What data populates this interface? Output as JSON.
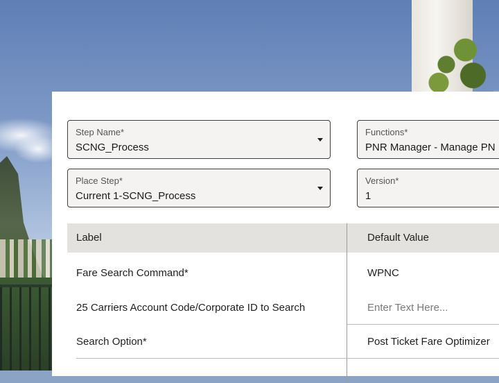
{
  "form": {
    "step_name": {
      "label": "Step Name*",
      "value": "SCNG_Process"
    },
    "functions": {
      "label": "Functions*",
      "value": "PNR Manager - Manage PN"
    },
    "place_step": {
      "label": "Place Step*",
      "value": "Current 1-SCNG_Process"
    },
    "version": {
      "label": "Version*",
      "value": "1"
    }
  },
  "table": {
    "headers": {
      "label": "Label",
      "default_value": "Default Value"
    },
    "rows": [
      {
        "label": "Fare Search Command*",
        "value": "WPNC"
      },
      {
        "label": "25 Carriers Account Code/Corporate ID to Search",
        "placeholder": "Enter Text Here..."
      },
      {
        "label": "Search Option*",
        "value": "Post Ticket Fare Optimizer"
      }
    ]
  },
  "icons": [
    "dropdown-caret-icon"
  ],
  "colors": {
    "panel_bg": "#ffffff",
    "field_bg": "#f4f3f1",
    "header_bg": "#e3e2de",
    "border": "#3e3e3e"
  }
}
